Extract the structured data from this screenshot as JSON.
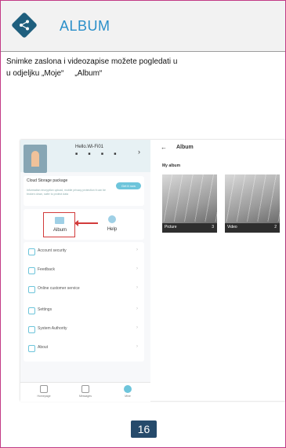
{
  "header": {
    "title": "ALBUM",
    "logo_icon": "share-icon",
    "colors": {
      "title": "#2a8fc9",
      "logo": "#1f5f7e",
      "border": "#c23a86"
    }
  },
  "description": {
    "line1": "Snimke zaslona i videozapise možete pogledati u",
    "line2": "u odjeljku „Moje“     „Album“"
  },
  "phone_left": {
    "greeting": "Hello.Wi-Fi01",
    "dots": "■   ■ ■ ■",
    "cloud": {
      "title": "Cloud Storage package",
      "subtitle": "Information encryption upload, mobile privacy protection it can be broken down, safer to protect data",
      "button": "Get it now"
    },
    "album_label": "Album",
    "help_label": "Help",
    "menu": [
      {
        "label": "Account security",
        "icon": "shield-icon"
      },
      {
        "label": "Feedback",
        "icon": "edit-icon"
      },
      {
        "label": "Online customer service",
        "icon": "headset-icon"
      },
      {
        "label": "Settings",
        "icon": "gear-icon"
      },
      {
        "label": "System Authority",
        "icon": "lock-icon"
      },
      {
        "label": "About",
        "icon": "info-icon"
      }
    ],
    "tabs": [
      {
        "label": "Homepage",
        "icon": "home-icon"
      },
      {
        "label": "Messages",
        "icon": "message-icon"
      },
      {
        "label": "Mine",
        "icon": "user-icon"
      }
    ]
  },
  "phone_right": {
    "title": "Album",
    "section": "My album",
    "albums": [
      {
        "name": "Picture",
        "count": "3"
      },
      {
        "name": "Video",
        "count": "2"
      }
    ]
  },
  "page_number": "16"
}
